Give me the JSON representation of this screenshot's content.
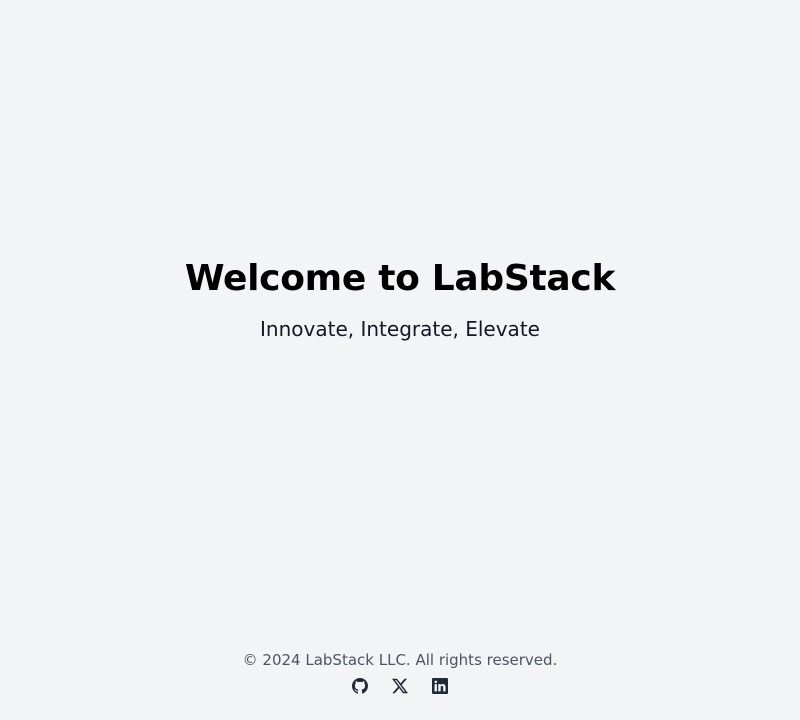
{
  "hero": {
    "title": "Welcome to LabStack",
    "tagline": "Innovate, Integrate, Elevate"
  },
  "footer": {
    "copyright": "© 2024 LabStack LLC. All rights reserved.",
    "social_links": [
      {
        "icon": "github-icon"
      },
      {
        "icon": "x-icon"
      },
      {
        "icon": "linkedin-icon"
      }
    ]
  },
  "colors": {
    "background": "#f3f4f6",
    "title": "#000000",
    "footer_text": "#4b5563",
    "icon": "#1f2937"
  }
}
